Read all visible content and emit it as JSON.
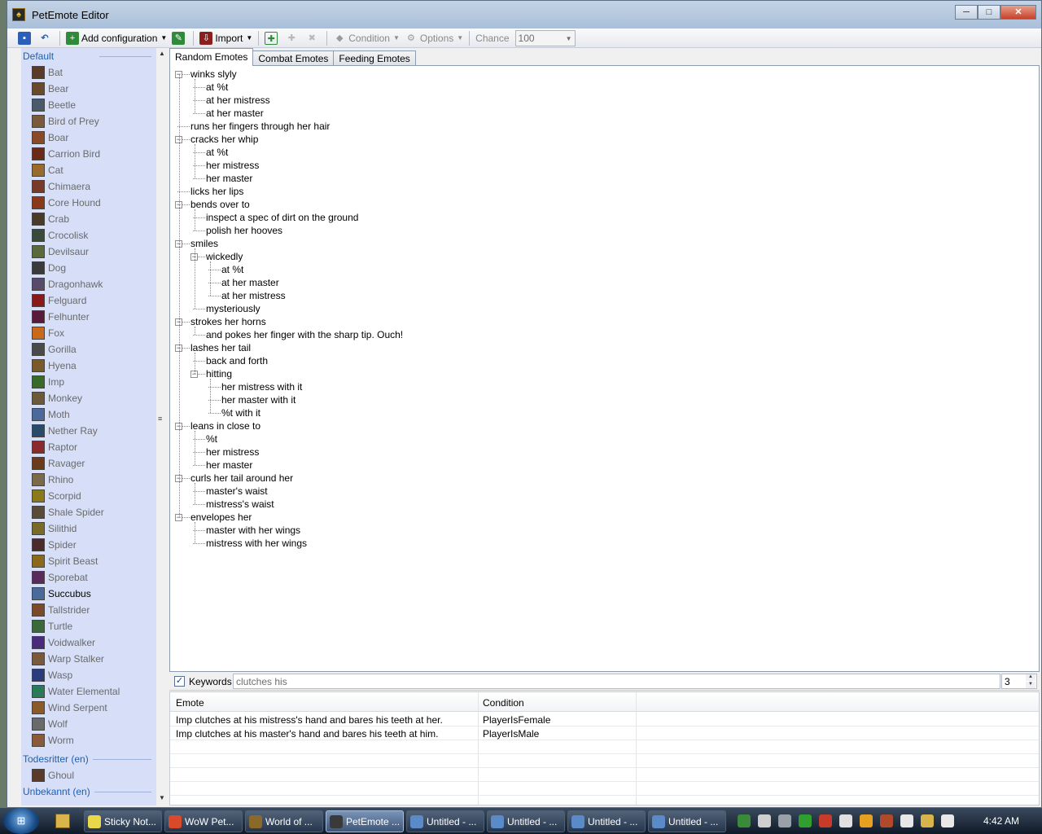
{
  "window": {
    "title": "PetEmote Editor",
    "minimize": "─",
    "maximize": "□",
    "close": "✕"
  },
  "toolbar": {
    "add_configuration": "Add configuration",
    "import": "Import",
    "condition": "Condition",
    "options": "Options",
    "chance_label": "Chance",
    "chance_value": "100"
  },
  "sidebar": {
    "groups": [
      {
        "label": "Default",
        "items": [
          "Bat",
          "Bear",
          "Beetle",
          "Bird of Prey",
          "Boar",
          "Carrion Bird",
          "Cat",
          "Chimaera",
          "Core Hound",
          "Crab",
          "Crocolisk",
          "Devilsaur",
          "Dog",
          "Dragonhawk",
          "Felguard",
          "Felhunter",
          "Fox",
          "Gorilla",
          "Hyena",
          "Imp",
          "Monkey",
          "Moth",
          "Nether Ray",
          "Raptor",
          "Ravager",
          "Rhino",
          "Scorpid",
          "Shale Spider",
          "Silithid",
          "Spider",
          "Spirit Beast",
          "Sporebat",
          "Succubus",
          "Tallstrider",
          "Turtle",
          "Voidwalker",
          "Warp Stalker",
          "Wasp",
          "Water Elemental",
          "Wind Serpent",
          "Wolf",
          "Worm"
        ],
        "selected": "Succubus"
      },
      {
        "label": "Todesritter (en)",
        "items": [
          "Ghoul"
        ]
      },
      {
        "label": "Unbekannt (en)",
        "items": []
      }
    ]
  },
  "tabs": [
    "Random Emotes",
    "Combat Emotes",
    "Feeding Emotes"
  ],
  "tree": [
    {
      "text": "winks slyly",
      "level": 0,
      "expander": true
    },
    {
      "text": "at %t",
      "level": 1
    },
    {
      "text": "at her mistress",
      "level": 1
    },
    {
      "text": "at her master",
      "level": 1
    },
    {
      "text": "runs her fingers through her hair",
      "level": 0
    },
    {
      "text": "cracks her whip",
      "level": 0,
      "expander": true
    },
    {
      "text": "at %t",
      "level": 1
    },
    {
      "text": "her mistress",
      "level": 1
    },
    {
      "text": "her master",
      "level": 1
    },
    {
      "text": "licks her lips",
      "level": 0
    },
    {
      "text": "bends over to",
      "level": 0,
      "expander": true
    },
    {
      "text": "inspect a spec of dirt on the ground",
      "level": 1
    },
    {
      "text": "polish her hooves",
      "level": 1
    },
    {
      "text": "smiles",
      "level": 0,
      "expander": true
    },
    {
      "text": "wickedly",
      "level": 1,
      "expander": true
    },
    {
      "text": "at %t",
      "level": 2
    },
    {
      "text": "at her master",
      "level": 2
    },
    {
      "text": "at her mistress",
      "level": 2
    },
    {
      "text": "mysteriously",
      "level": 1
    },
    {
      "text": "strokes her horns",
      "level": 0,
      "expander": true
    },
    {
      "text": "and pokes her finger with the sharp tip. Ouch!",
      "level": 1
    },
    {
      "text": "lashes her tail",
      "level": 0,
      "expander": true
    },
    {
      "text": "back and forth",
      "level": 1
    },
    {
      "text": "hitting",
      "level": 1,
      "expander": true
    },
    {
      "text": "her mistress with it",
      "level": 2
    },
    {
      "text": "her master with it",
      "level": 2
    },
    {
      "text": "%t with it",
      "level": 2
    },
    {
      "text": "leans in close to",
      "level": 0,
      "expander": true
    },
    {
      "text": "%t",
      "level": 1
    },
    {
      "text": "her mistress",
      "level": 1
    },
    {
      "text": "her master",
      "level": 1
    },
    {
      "text": "curls her tail around her",
      "level": 0,
      "expander": true
    },
    {
      "text": "master's waist",
      "level": 1
    },
    {
      "text": "mistress's waist",
      "level": 1
    },
    {
      "text": "envelopes her",
      "level": 0,
      "expander": true
    },
    {
      "text": "master with her wings",
      "level": 1
    },
    {
      "text": "mistress with her wings",
      "level": 1
    }
  ],
  "keywords": {
    "checked": true,
    "label": "Keywords",
    "value": "clutches his",
    "count": "3"
  },
  "preview": {
    "columns": [
      "Emote",
      "Condition"
    ],
    "rows": [
      [
        "Imp clutches at his mistress's hand and bares his teeth at her.",
        "PlayerIsFemale"
      ],
      [
        "Imp clutches at his master's hand and bares his teeth at him.",
        "PlayerIsMale"
      ]
    ]
  },
  "taskbar": {
    "tasks": [
      "Sticky Not...",
      "WoW Pet...",
      "World of ...",
      "PetEmote ...",
      "Untitled - ...",
      "Untitled - ...",
      "Untitled - ...",
      "Untitled - ..."
    ],
    "active": "PetEmote ...",
    "clock": "4:42 AM"
  },
  "colors": {
    "sidebar_bg": "#d6dff7",
    "group_header": "#1f5fb0",
    "disabled_text": "#6a6a6a"
  }
}
